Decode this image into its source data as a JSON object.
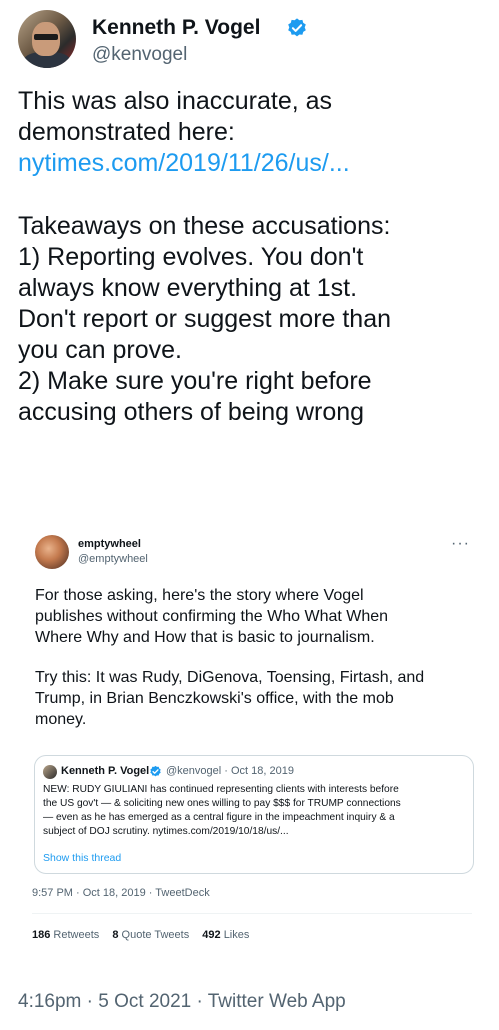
{
  "tweet": {
    "author": {
      "name": "Kenneth P. Vogel",
      "handle": "@kenvogel"
    },
    "lines": [
      "This was also inaccurate, as",
      "demonstrated here:"
    ],
    "link": "nytimes.com/2019/11/26/us/...",
    "lines2": [
      "Takeaways on these accusations:",
      "1) Reporting evolves. You don't",
      "always know everything at 1st.",
      "Don't report or suggest more than",
      "you can prove.",
      "2) Make sure you're right before",
      "accusing others of being wrong"
    ],
    "timestamp": "4:16pm · 5 Oct 2021 · Twitter Web App"
  },
  "quoted": {
    "author": {
      "name": "emptywheel",
      "handle": "@emptywheel"
    },
    "more": "···",
    "paragraph1": [
      "For those asking, here's the story where Vogel",
      "publishes without confirming the Who What When",
      "Where Why and How that is basic to journalism."
    ],
    "paragraph2": [
      "Try this: It was Rudy, DiGenova, Toensing, Firtash, and",
      "Trump, in Brian Benczkowski's office, with the mob",
      "money."
    ],
    "inner": {
      "name": "Kenneth P. Vogel",
      "meta": "@kenvogel · Oct 18, 2019",
      "lines": [
        "NEW: RUDY GIULIANI has continued representing clients with interests before",
        "the US gov't — & soliciting new ones willing to pay $$$ for TRUMP connections",
        "— even as he has emerged as a central figure in the impeachment inquiry & a",
        "subject of DOJ scrutiny. nytimes.com/2019/10/18/us/..."
      ],
      "show_thread": "Show this thread"
    },
    "time": "9:57 PM · Oct 18, 2019 · TweetDeck",
    "stats": {
      "retweets_count": "186",
      "retweets_label": "Retweets",
      "quotes_count": "8",
      "quotes_label": "Quote Tweets",
      "likes_count": "492",
      "likes_label": "Likes"
    }
  },
  "colors": {
    "link": "#1d9bf0",
    "secondary": "#536471",
    "text": "#0f1419"
  }
}
